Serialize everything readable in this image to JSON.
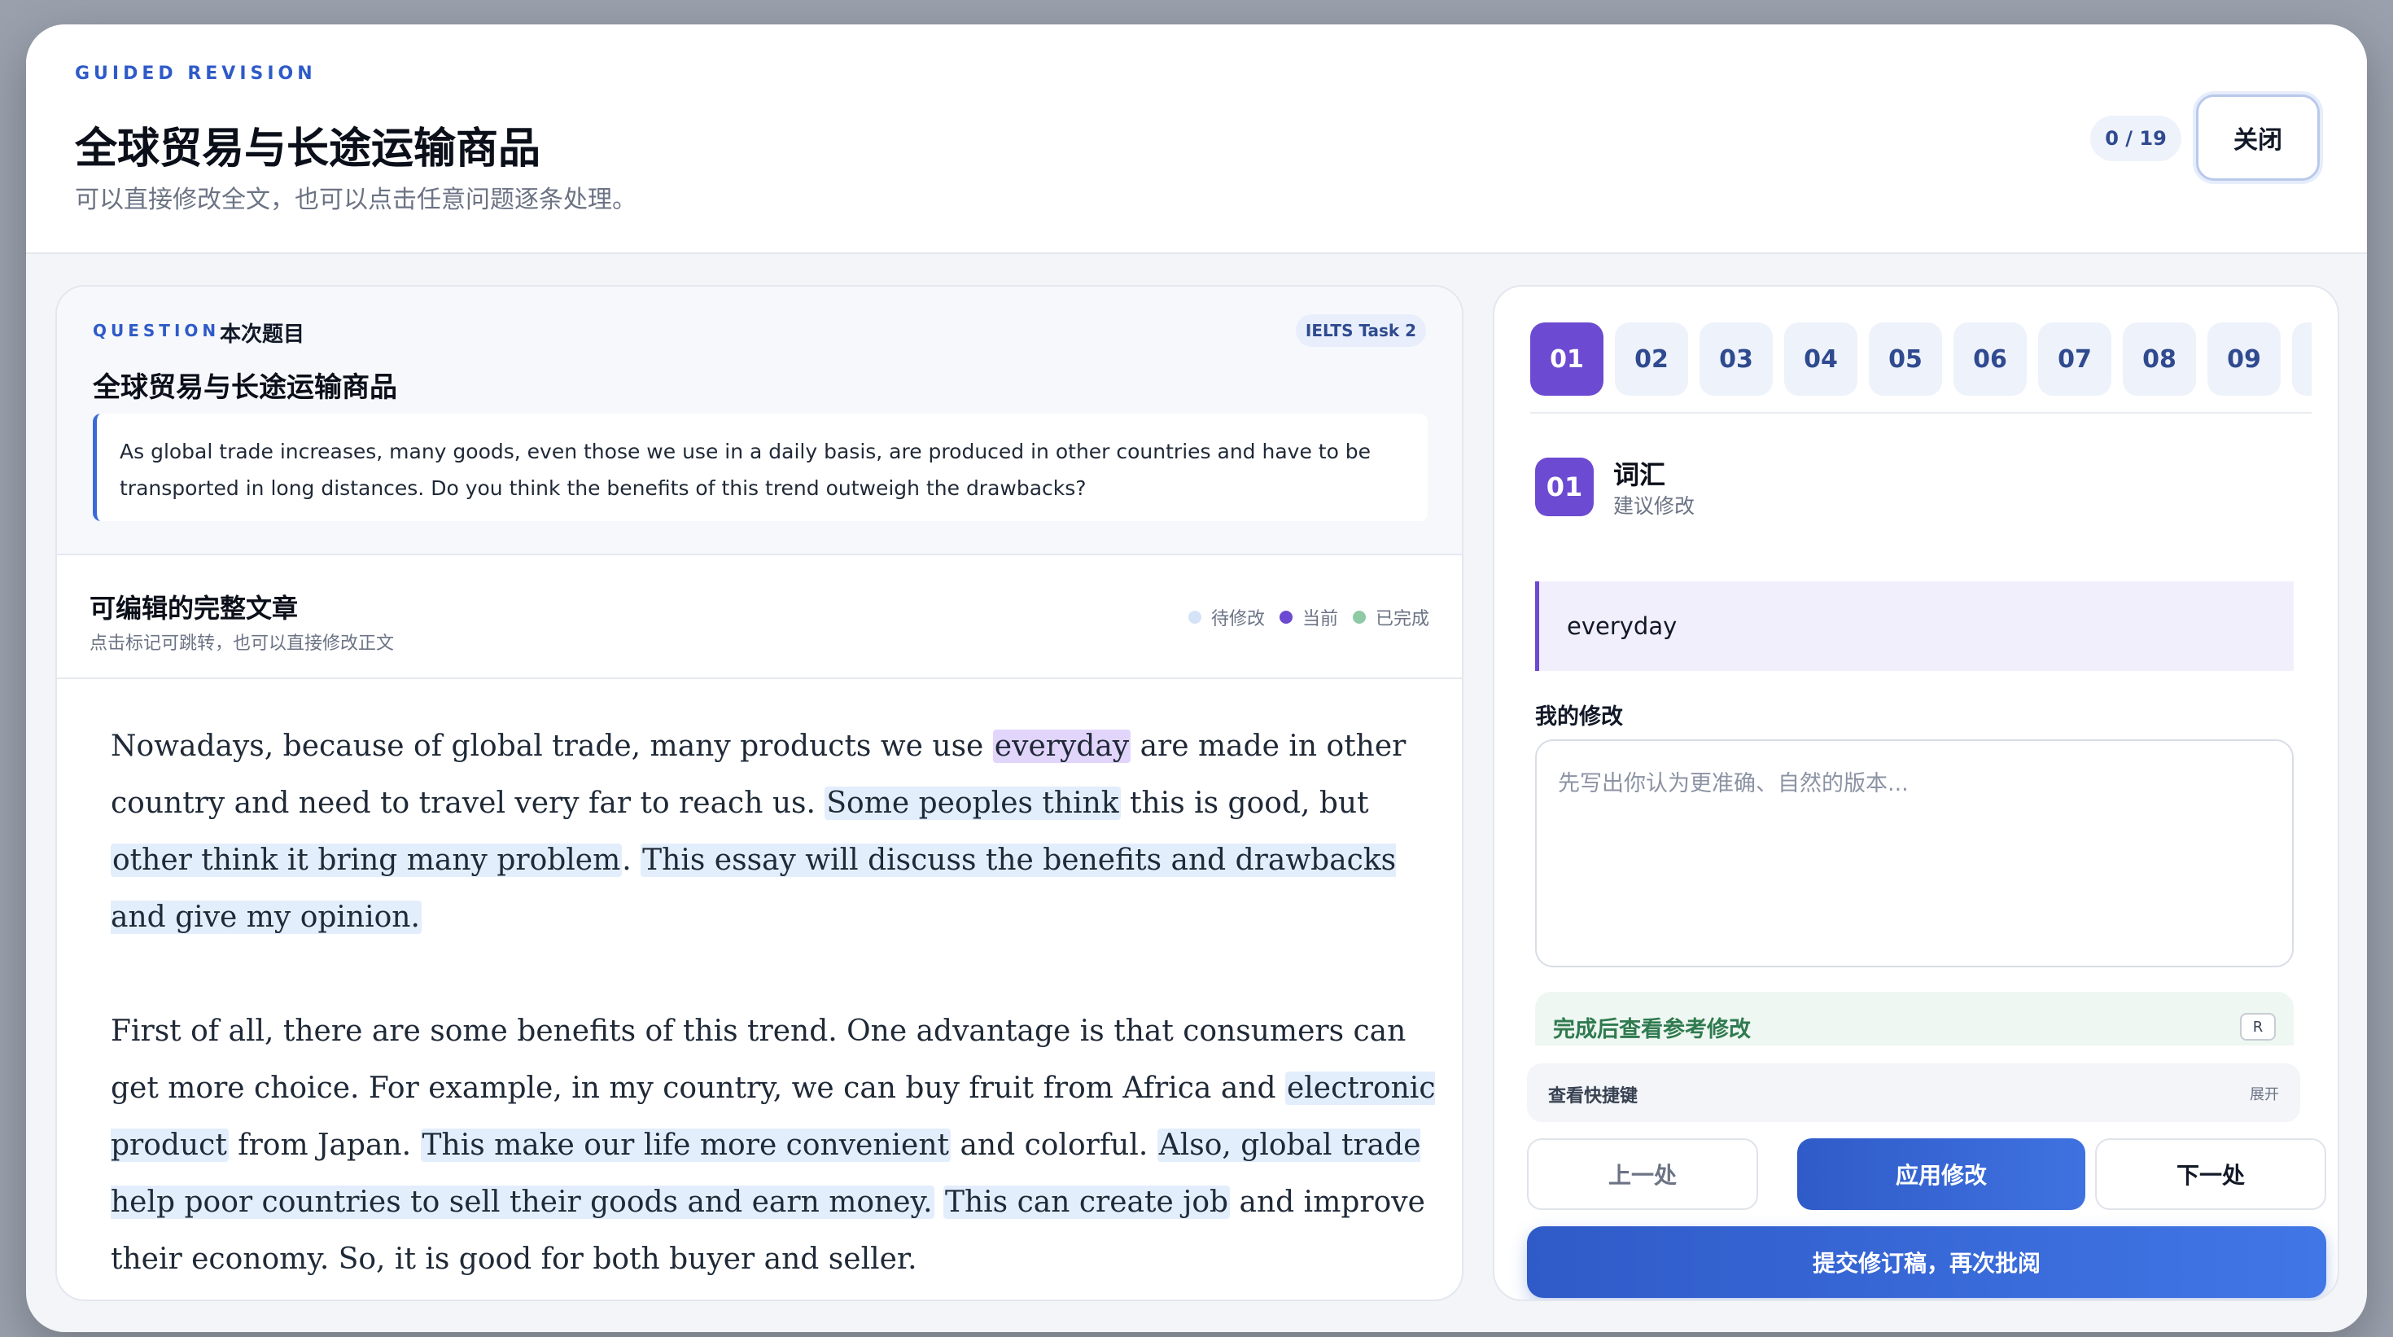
{
  "header": {
    "eyebrow": "GUIDED REVISION",
    "title": "全球贸易与长途运输商品",
    "subtitle": "可以直接修改全文，也可以点击任意问题逐条处理。",
    "progress": "0 / 19",
    "close_label": "关闭"
  },
  "question": {
    "eyebrow": "QUESTION",
    "label": "本次题目",
    "badge": "IELTS Task 2",
    "title": "全球贸易与长途运输商品",
    "prompt": "As global trade increases, many goods, even those we use in a daily basis, are produced in other countries and have to be transported in long distances. Do you think the benefits of this trend outweigh the drawbacks?"
  },
  "essay": {
    "title": "可编辑的完整文章",
    "subtitle": "点击标记可跳转，也可以直接修改正文",
    "legend": {
      "pending": "待修改",
      "current": "当前",
      "done": "已完成",
      "pending_color": "#d4e3f7",
      "current_color": "#6c4ad1",
      "done_color": "#8fcaa5"
    },
    "p1": {
      "a": "Nowadays, because of global trade, many products we use ",
      "b": "everyday",
      "c": " are made in other country and need to travel very far to reach us. ",
      "d": "Some peoples think",
      "e": " this is good, but ",
      "f": "other think it bring many problem",
      "g": ". ",
      "h": "This essay will discuss the benefits and drawbacks and give my opinion."
    },
    "p2": {
      "a": "First of all, there are some benefits of this trend. One advantage is that consumers can get more choice. For example, in my country, we can buy fruit from Africa and ",
      "b": "electronic product",
      "c": " from Japan. ",
      "d": "This make our life more convenient",
      "e": " and colorful. ",
      "f": "Also, global trade help poor countries to sell their goods and earn money.",
      "g": " ",
      "h": "This can create job",
      "i": " and improve their economy. So, it is good for both buyer and seller."
    }
  },
  "issues": {
    "chips": [
      "01",
      "02",
      "03",
      "04",
      "05",
      "06",
      "07",
      "08",
      "09"
    ]
  },
  "current_issue": {
    "number": "01",
    "category": "词汇",
    "type": "建议修改",
    "original": "everyday",
    "my_label": "我的修改",
    "placeholder": "先写出你认为更准确、自然的版本...",
    "reference_label": "完成后查看参考修改",
    "reference_key": "R"
  },
  "shortcuts": {
    "label": "查看快捷键",
    "toggle": "展开"
  },
  "actions": {
    "prev": "上一处",
    "apply": "应用修改",
    "next": "下一处",
    "submit": "提交修订稿，再次批阅"
  }
}
